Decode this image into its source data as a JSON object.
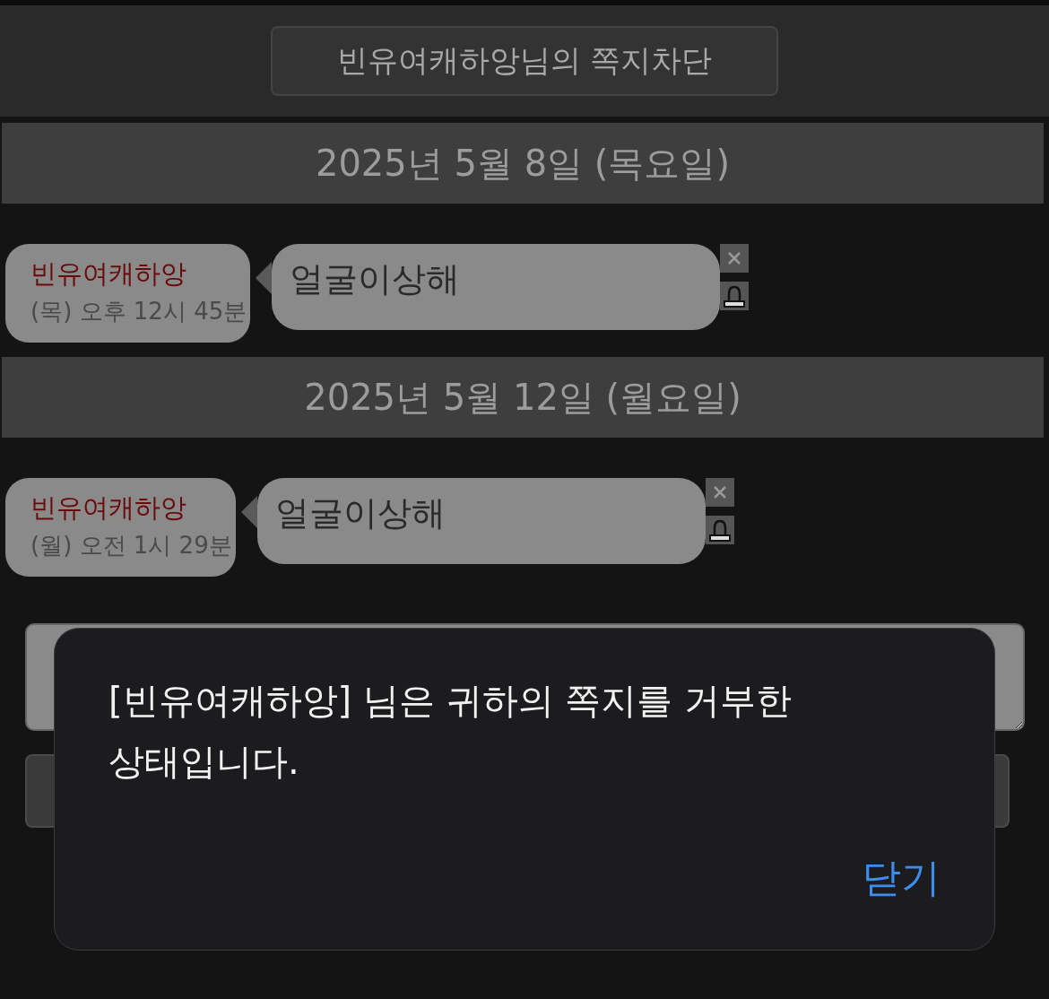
{
  "header": {
    "button": "빈유여캐하앙님의 쪽지차단"
  },
  "sections": [
    {
      "date": "2025년 5월 8일 (목요일)",
      "messages": [
        {
          "sender": "빈유여캐하앙",
          "time": "(목) 오후 12시 45분",
          "text": "얼굴이상해"
        }
      ]
    },
    {
      "date": "2025년 5월 12일 (월요일)",
      "messages": [
        {
          "sender": "빈유여캐하앙",
          "time": "(월) 오전 1시 29분",
          "text": "얼굴이상해"
        }
      ]
    }
  ],
  "dialog": {
    "message": "[빈유여캐하앙] 님은 귀하의 쪽지를 거부한 상태입니다.",
    "close": "닫기"
  }
}
